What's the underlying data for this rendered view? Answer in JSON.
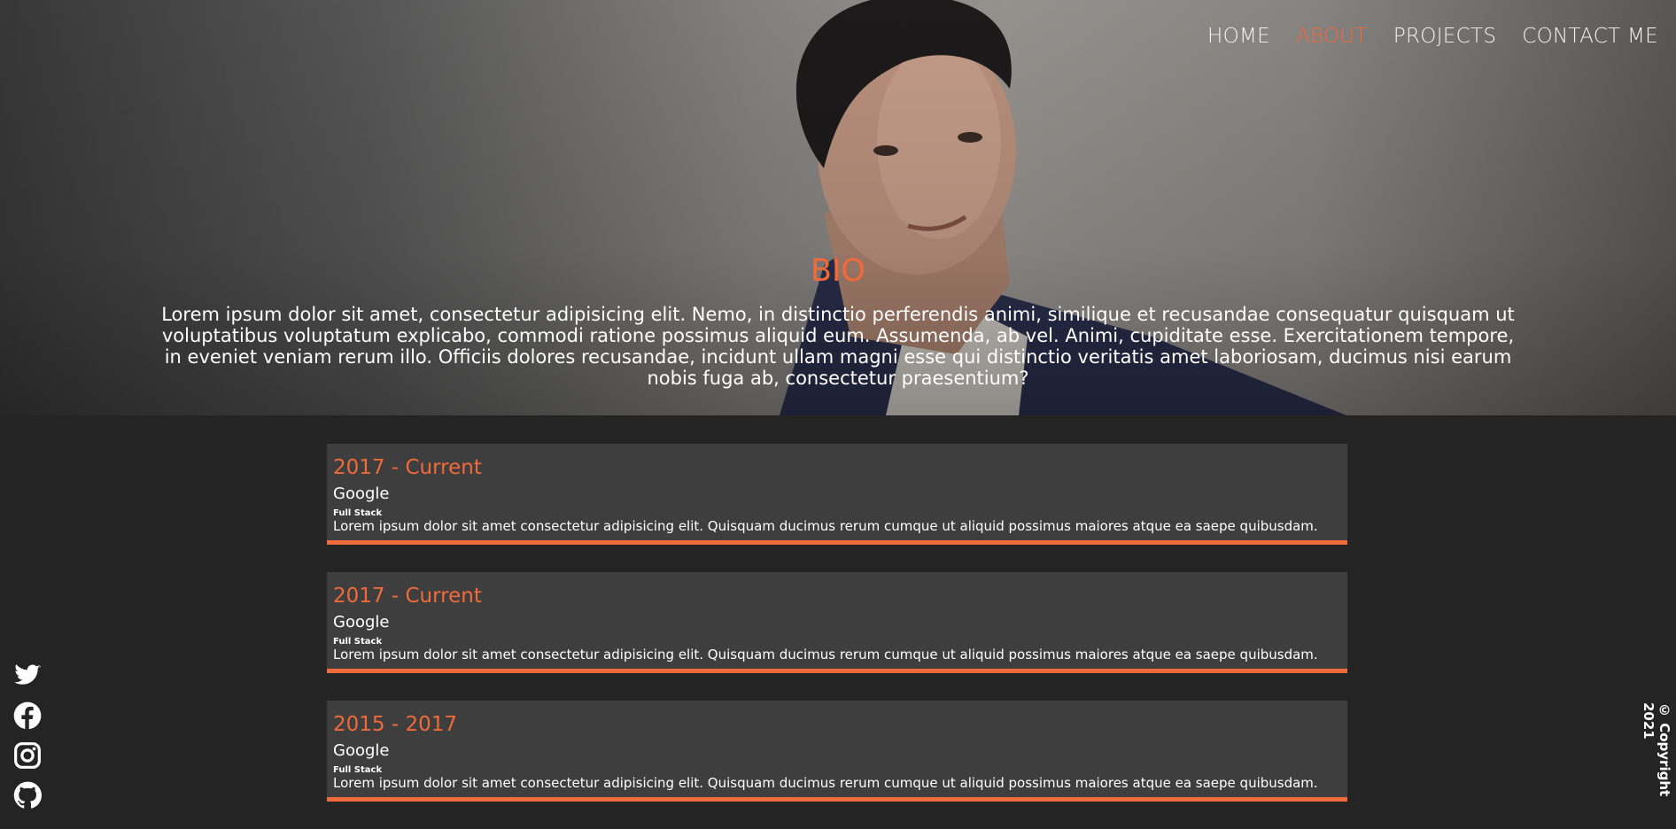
{
  "nav": {
    "items": [
      {
        "label": "HOME",
        "active": false
      },
      {
        "label": "ABOUT",
        "active": true
      },
      {
        "label": "PROJECTS",
        "active": false
      },
      {
        "label": "CONTACT ME",
        "active": false
      }
    ]
  },
  "hero": {
    "title": "BIO",
    "text": "Lorem ipsum dolor sit amet, consectetur adipisicing elit. Nemo, in distinctio perferendis animi, similique et recusandae consequatur quisquam ut voluptatibus voluptatum explicabo, commodi ratione possimus aliquid eum. Assumenda, ab vel. Animi, cupiditate esse. Exercitationem tempore, in eveniet veniam rerum illo. Officiis dolores recusandae, incidunt ullam magni esse qui distinctio veritatis amet laboriosam, ducimus nisi earum nobis fuga ab, consectetur praesentium?"
  },
  "experience": [
    {
      "date": "2017 - Current",
      "company": "Google",
      "role": "Full Stack",
      "description": "Lorem ipsum dolor sit amet consectetur adipisicing elit. Quisquam ducimus rerum cumque ut aliquid possimus maiores atque ea saepe quibusdam."
    },
    {
      "date": "2017 - Current",
      "company": "Google",
      "role": "Full Stack",
      "description": "Lorem ipsum dolor sit amet consectetur adipisicing elit. Quisquam ducimus rerum cumque ut aliquid possimus maiores atque ea saepe quibusdam."
    },
    {
      "date": "2015 - 2017",
      "company": "Google",
      "role": "Full Stack",
      "description": "Lorem ipsum dolor sit amet consectetur adipisicing elit. Quisquam ducimus rerum cumque ut aliquid possimus maiores atque ea saepe quibusdam."
    }
  ],
  "social": [
    "twitter-icon",
    "facebook-icon",
    "instagram-icon",
    "github-icon"
  ],
  "footer": {
    "copyright": "© Copyright 2021"
  },
  "colors": {
    "accent": "#f06a3a",
    "background": "#242424",
    "card": "#3e3e3e"
  }
}
